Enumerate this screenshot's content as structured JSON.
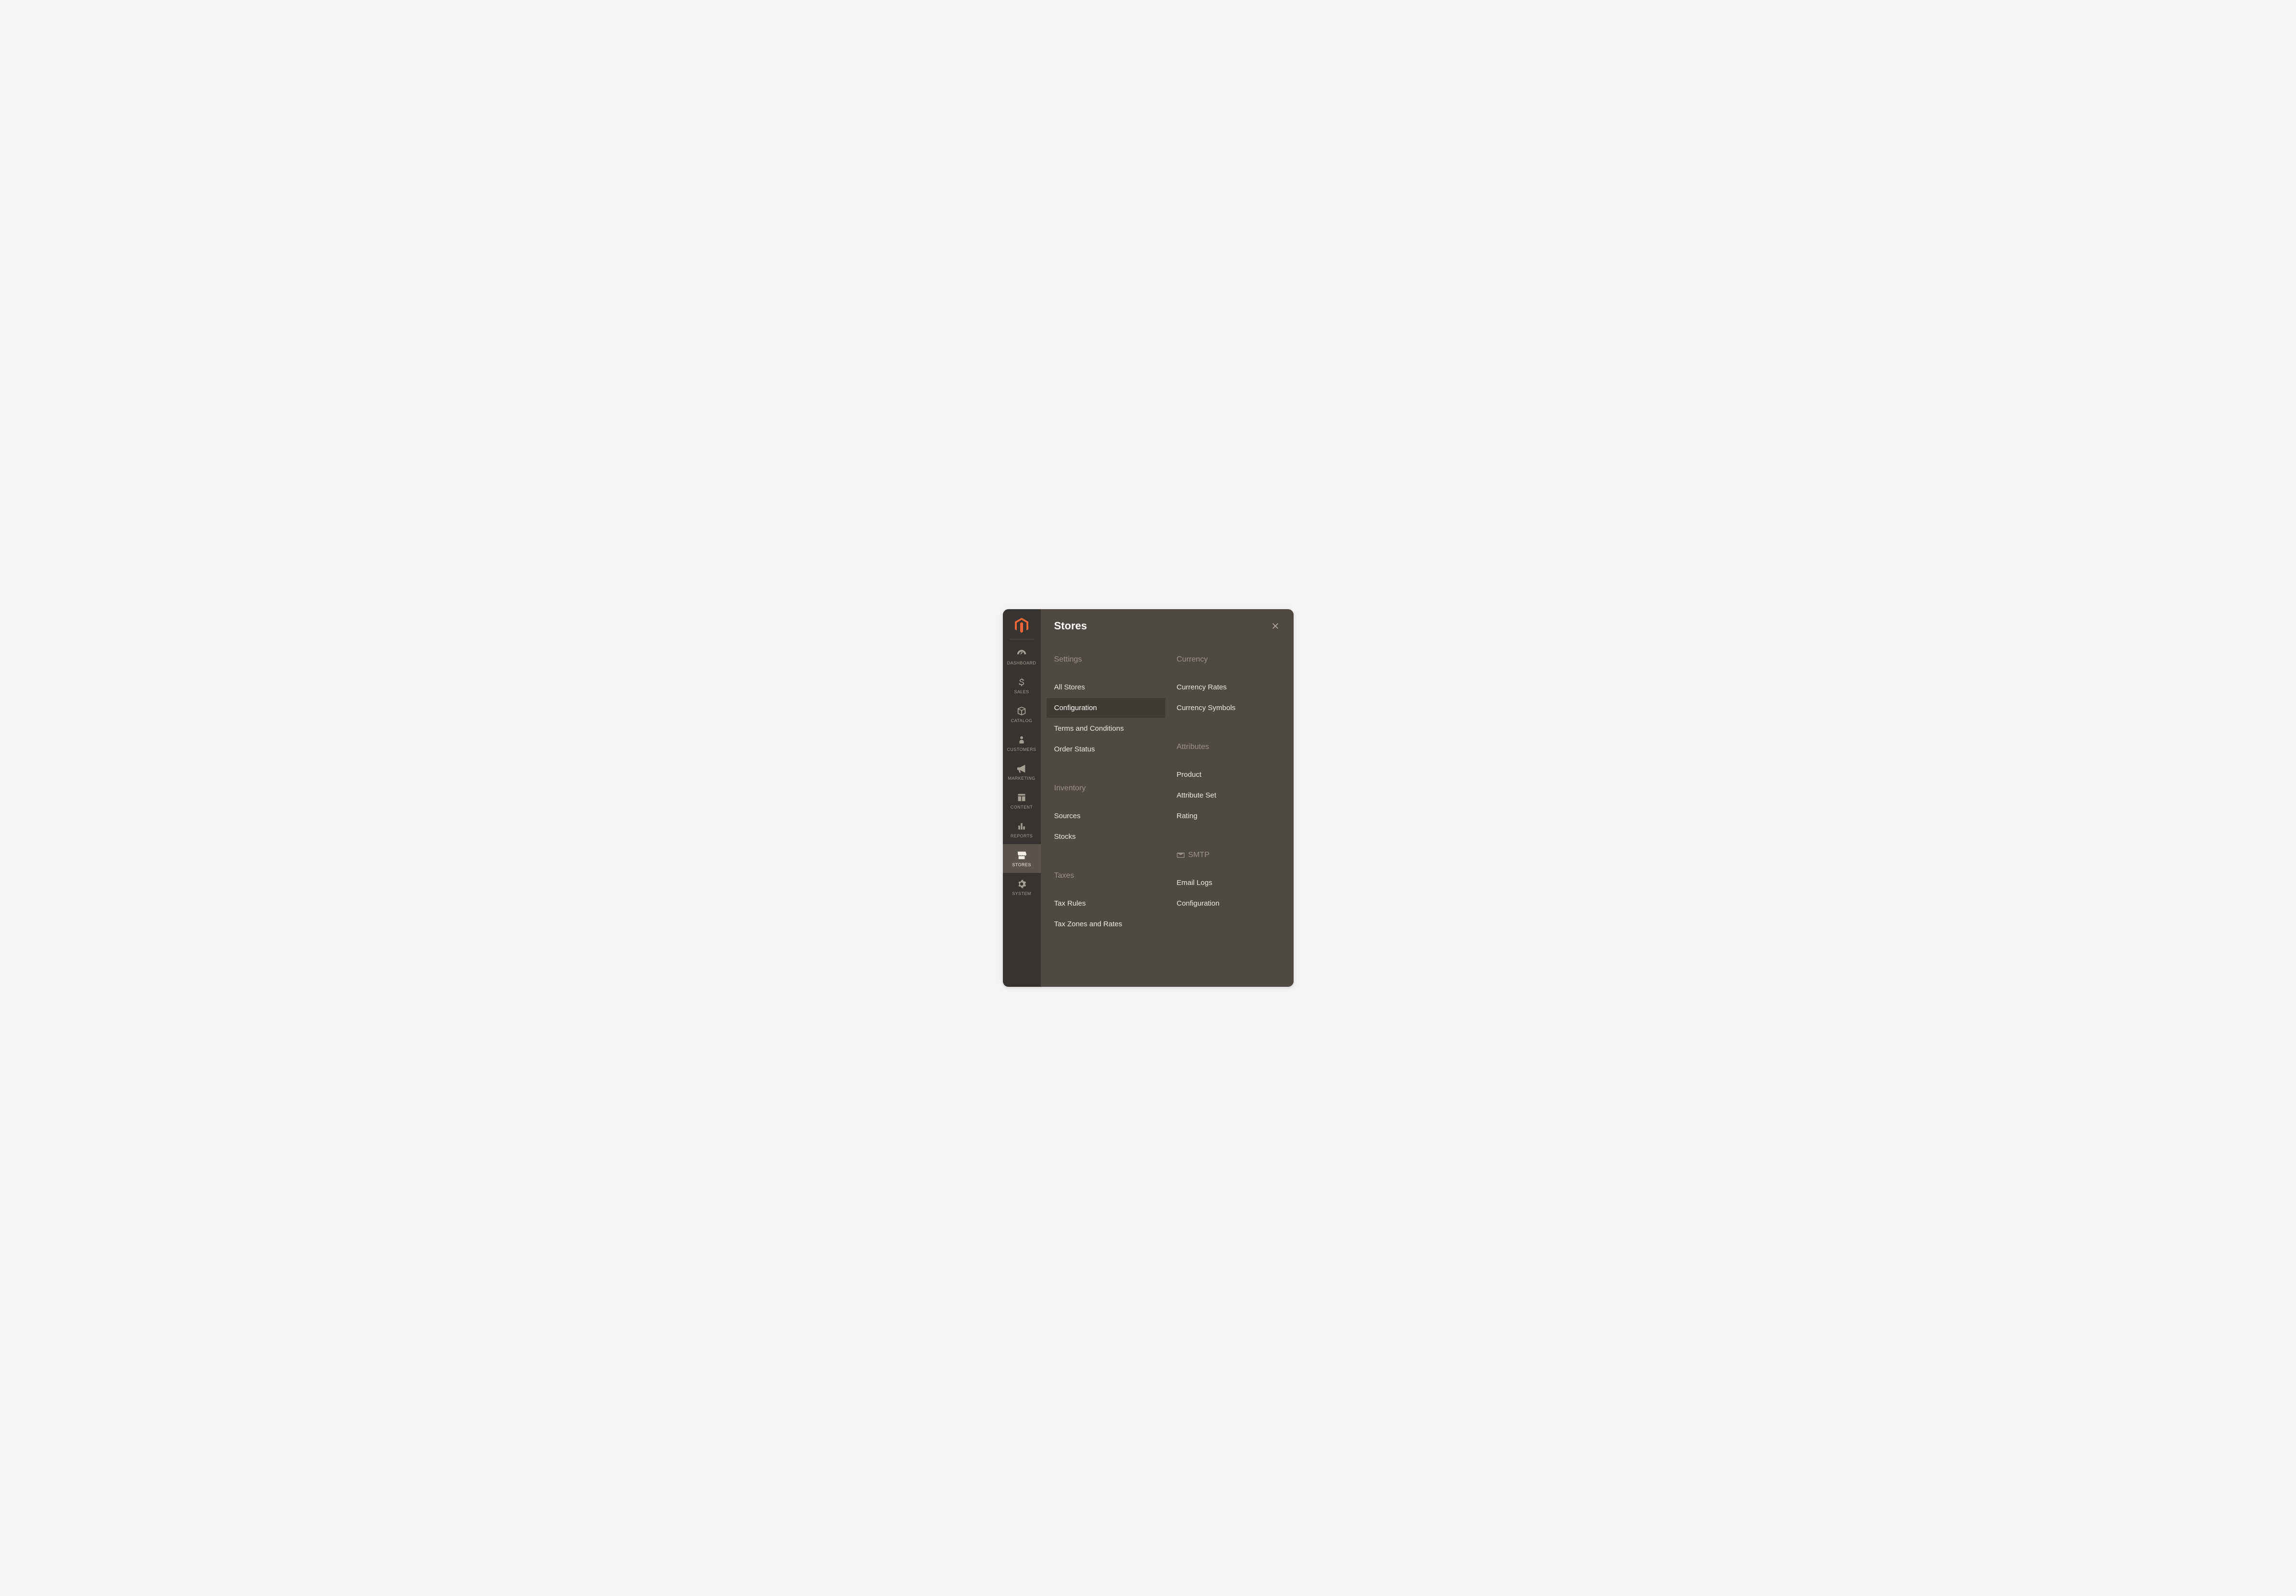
{
  "sidebar": {
    "items": [
      {
        "key": "dashboard",
        "label": "DASHBOARD"
      },
      {
        "key": "sales",
        "label": "SALES"
      },
      {
        "key": "catalog",
        "label": "CATALOG"
      },
      {
        "key": "customers",
        "label": "CUSTOMERS"
      },
      {
        "key": "marketing",
        "label": "MARKETING"
      },
      {
        "key": "content",
        "label": "CONTENT"
      },
      {
        "key": "reports",
        "label": "REPORTS"
      },
      {
        "key": "stores",
        "label": "STORES",
        "active": true
      },
      {
        "key": "system",
        "label": "SYSTEM"
      }
    ]
  },
  "flyout": {
    "title": "Stores",
    "left": {
      "settings": {
        "title": "Settings",
        "items": {
          "all_stores": "All Stores",
          "configuration": "Configuration",
          "terms": "Terms and Conditions",
          "order_status": "Order Status"
        },
        "activeKey": "configuration"
      },
      "inventory": {
        "title": "Inventory",
        "items": {
          "sources": "Sources",
          "stocks": "Stocks"
        }
      },
      "taxes": {
        "title": "Taxes",
        "items": {
          "tax_rules": "Tax Rules",
          "tax_zones": "Tax Zones and Rates"
        }
      }
    },
    "right": {
      "currency": {
        "title": "Currency",
        "items": {
          "rates": "Currency Rates",
          "symbols": "Currency Symbols"
        }
      },
      "attributes": {
        "title": "Attributes",
        "items": {
          "product": "Product",
          "attribute_set": "Attribute Set",
          "rating": "Rating"
        }
      },
      "smtp": {
        "title": "SMTP",
        "items": {
          "email_logs": "Email Logs",
          "configuration": "Configuration"
        }
      }
    }
  }
}
